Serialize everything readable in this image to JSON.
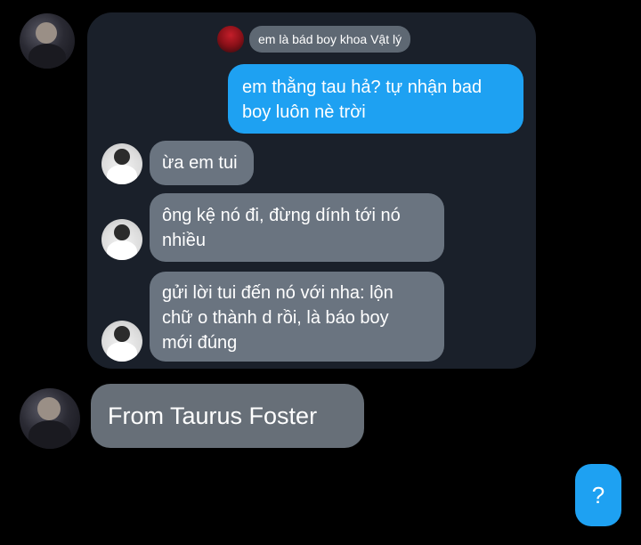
{
  "reply_preview": {
    "text": "em là bád boy khoa Vật lý"
  },
  "messages": [
    {
      "side": "sent",
      "text": "em thằng tau hả? tự nhận bad\nboy luôn nè trời"
    },
    {
      "side": "received",
      "text": "ừa em tui"
    },
    {
      "side": "received",
      "text": "ông kệ nó đi, đừng dính tới nó\nnhiều"
    },
    {
      "side": "received",
      "text": "gửi lời tui đến nó với nha: lộn\nchữ o thành d rồi, là báo boy\nmới đúng"
    }
  ],
  "footer": {
    "from_text": "From Taurus Foster"
  },
  "question_button": {
    "label": "?"
  },
  "colors": {
    "background": "#000000",
    "panel": "#1a202a",
    "received_bubble": "#6a7480",
    "sent_bubble": "#1ea1f2"
  }
}
